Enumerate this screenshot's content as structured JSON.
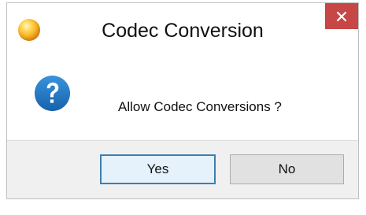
{
  "window": {
    "title": "Codec Conversion",
    "app_icon": "yellow-orb-icon",
    "close_icon": "close-x-icon",
    "close_color": "#c74646"
  },
  "message": {
    "icon": "question-icon",
    "icon_color": "#1e73be",
    "text": "Allow Codec Conversions ?"
  },
  "buttons": {
    "yes_label": "Yes",
    "no_label": "No",
    "default": "Yes"
  }
}
